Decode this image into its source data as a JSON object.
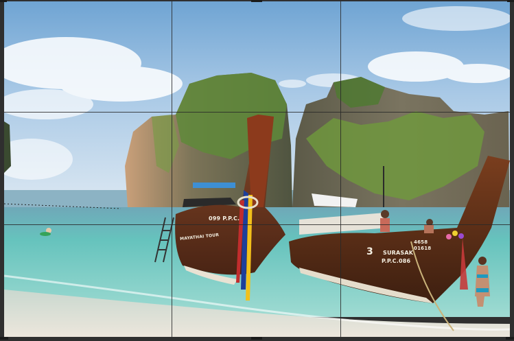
{
  "overlay": {
    "type": "rule-of-thirds crop grid",
    "line_color": "#2a2a2a",
    "handle_color": "#1a1a1a"
  },
  "photo": {
    "subject": "longtail boats at beach",
    "boat_left": {
      "lines": [
        "099 P.P.C.",
        "MAYATHAI TOUR"
      ]
    },
    "boat_right": {
      "lines": [
        "3",
        "SURASAK",
        "P.P.C.086",
        "4658",
        "01618"
      ]
    }
  },
  "colors": {
    "sky": "#7fb0d9",
    "water": "#62c7c0",
    "sand": "#e6dfd4",
    "cliff": "#6f6a52",
    "boat_wood": "#6b3418"
  }
}
